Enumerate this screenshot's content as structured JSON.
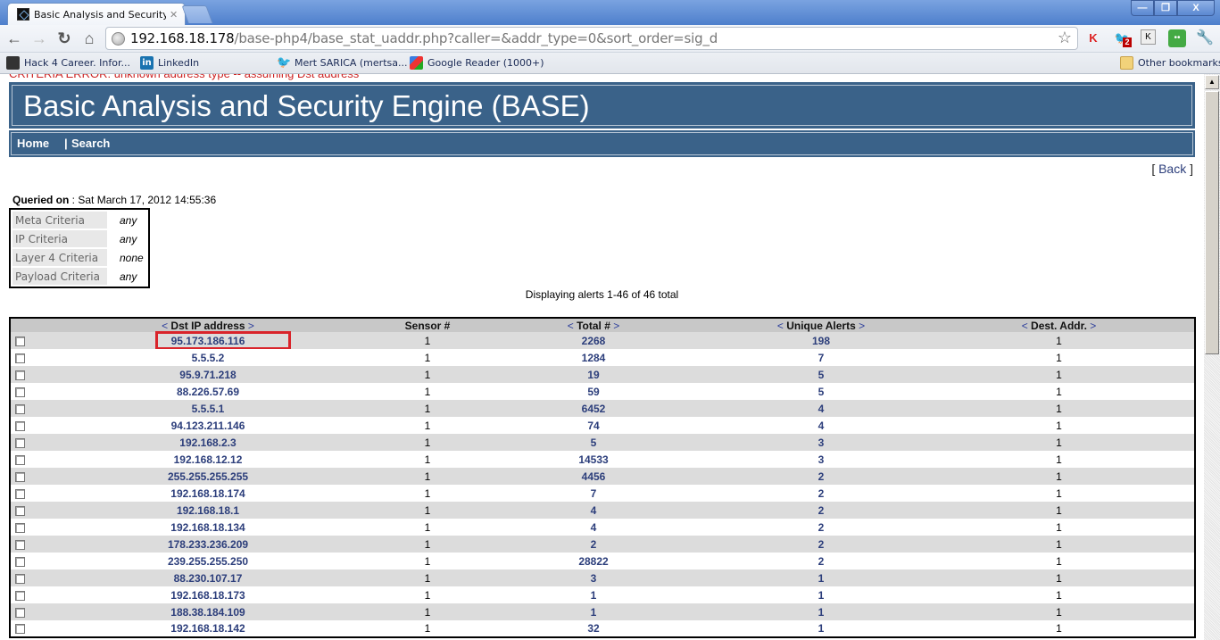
{
  "browser": {
    "tab_title": "Basic Analysis and Security Engine (BASE)",
    "tab_title_visible": "Basic Analysis and Security En",
    "url_host": "192.168.18.178",
    "url_path": "/base-php4/base_stat_uaddr.php?caller=&addr_type=0&sort_order=sig_d",
    "window_controls": {
      "minimize": "—",
      "restore": "❐",
      "close": "X"
    },
    "extension_badge": "2",
    "bookmarks": [
      {
        "label": "Hack 4 Career. Infor...",
        "icon": "hacker-icon"
      },
      {
        "label": "LinkedIn",
        "icon": "linkedin-icon"
      },
      {
        "label": "Mert SARICA (mertsa...",
        "icon": "twitter-icon"
      },
      {
        "label": "Google Reader (1000+)",
        "icon": "google-icon"
      }
    ],
    "other_bookmarks": "Other bookmarks"
  },
  "page": {
    "criteria_error": "CRITERIA ERROR: unknown address type -- assuming Dst address",
    "app_title": "Basic Analysis and Security Engine (BASE)",
    "nav": {
      "home": "Home",
      "separator": "|",
      "search": "Search"
    },
    "back": {
      "open": "[",
      "label": "Back",
      "close": "]"
    },
    "queried_label": "Queried on",
    "queried_value": " : Sat March 17, 2012 14:55:36",
    "criteria": [
      {
        "name": "Meta Criteria",
        "value": "any"
      },
      {
        "name": "IP Criteria",
        "value": "any"
      },
      {
        "name": "Layer 4 Criteria",
        "value": "none"
      },
      {
        "name": "Payload Criteria",
        "value": "any"
      }
    ],
    "displaying": "Displaying alerts 1-46 of 46 total",
    "table": {
      "headers": {
        "dst_ip": "Dst IP address",
        "sensor": "Sensor #",
        "total": "Total #",
        "unique": "Unique Alerts",
        "dest_addr": "Dest. Addr."
      },
      "sort_left": "<",
      "sort_right": ">",
      "highlighted_row": 0,
      "rows": [
        {
          "ip": "95.173.186.116",
          "sensor": "1",
          "total": "2268",
          "unique": "198",
          "dest": "1"
        },
        {
          "ip": "5.5.5.2",
          "sensor": "1",
          "total": "1284",
          "unique": "7",
          "dest": "1"
        },
        {
          "ip": "95.9.71.218",
          "sensor": "1",
          "total": "19",
          "unique": "5",
          "dest": "1"
        },
        {
          "ip": "88.226.57.69",
          "sensor": "1",
          "total": "59",
          "unique": "5",
          "dest": "1"
        },
        {
          "ip": "5.5.5.1",
          "sensor": "1",
          "total": "6452",
          "unique": "4",
          "dest": "1"
        },
        {
          "ip": "94.123.211.146",
          "sensor": "1",
          "total": "74",
          "unique": "4",
          "dest": "1"
        },
        {
          "ip": "192.168.2.3",
          "sensor": "1",
          "total": "5",
          "unique": "3",
          "dest": "1"
        },
        {
          "ip": "192.168.12.12",
          "sensor": "1",
          "total": "14533",
          "unique": "3",
          "dest": "1"
        },
        {
          "ip": "255.255.255.255",
          "sensor": "1",
          "total": "4456",
          "unique": "2",
          "dest": "1"
        },
        {
          "ip": "192.168.18.174",
          "sensor": "1",
          "total": "7",
          "unique": "2",
          "dest": "1"
        },
        {
          "ip": "192.168.18.1",
          "sensor": "1",
          "total": "4",
          "unique": "2",
          "dest": "1"
        },
        {
          "ip": "192.168.18.134",
          "sensor": "1",
          "total": "4",
          "unique": "2",
          "dest": "1"
        },
        {
          "ip": "178.233.236.209",
          "sensor": "1",
          "total": "2",
          "unique": "2",
          "dest": "1"
        },
        {
          "ip": "239.255.255.250",
          "sensor": "1",
          "total": "28822",
          "unique": "2",
          "dest": "1"
        },
        {
          "ip": "88.230.107.17",
          "sensor": "1",
          "total": "3",
          "unique": "1",
          "dest": "1"
        },
        {
          "ip": "192.168.18.173",
          "sensor": "1",
          "total": "1",
          "unique": "1",
          "dest": "1"
        },
        {
          "ip": "188.38.184.109",
          "sensor": "1",
          "total": "1",
          "unique": "1",
          "dest": "1"
        },
        {
          "ip": "192.168.18.142",
          "sensor": "1",
          "total": "32",
          "unique": "1",
          "dest": "1"
        }
      ]
    }
  },
  "colors": {
    "header_blue": "#3a6289",
    "link_blue": "#2c3e7b",
    "error_red": "#cc2222",
    "highlight_red": "#d9242b",
    "row_alt": "#dcdcdc"
  }
}
